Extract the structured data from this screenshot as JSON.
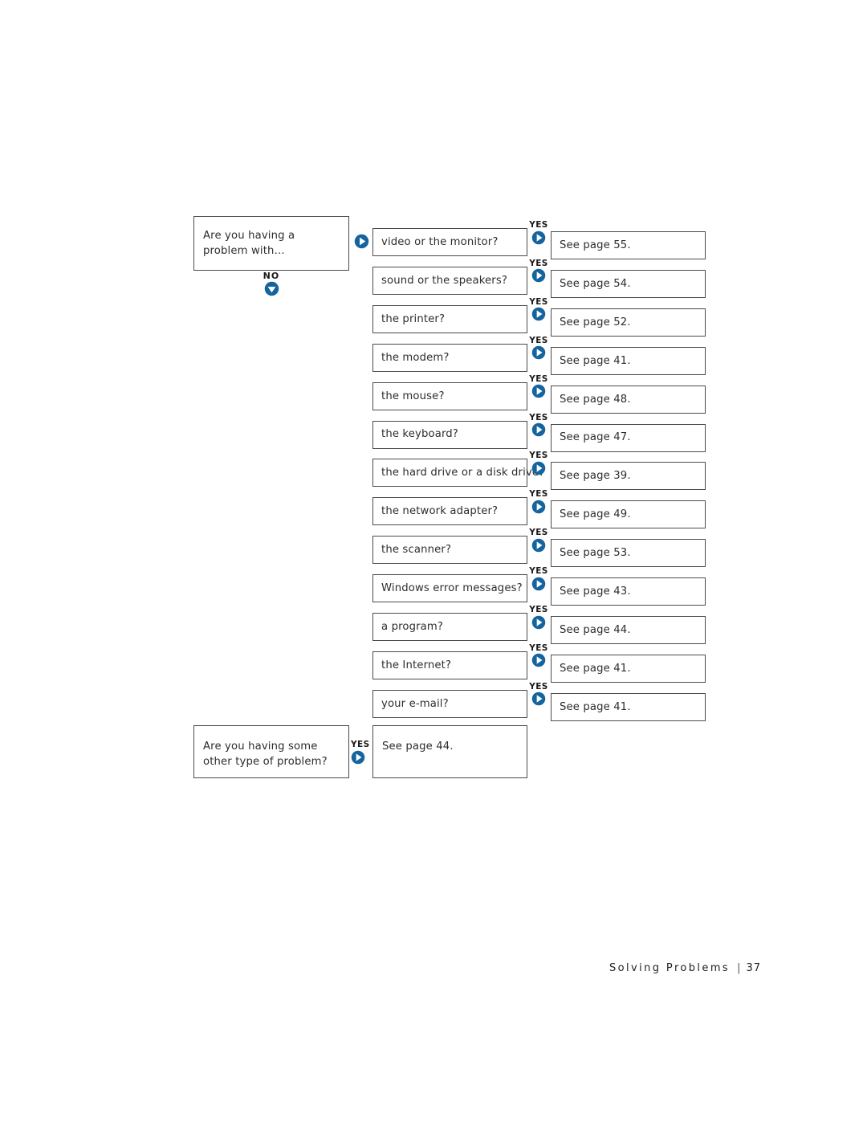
{
  "page": {
    "footer_title": "Solving Problems",
    "footer_separator": "|",
    "footer_page_number": "37"
  },
  "colors": {
    "accent_blue": "#1464A0",
    "border_gray": "#4a4a4a",
    "text_dark": "#2d2d2d",
    "background": "#ffffff"
  },
  "flowchart": {
    "root": {
      "label": "Are you having a problem with…",
      "no_branch": {
        "label": "NO",
        "icon": "circle-arrow-down-icon"
      },
      "yes_icon": "circle-arrow-right-icon"
    },
    "branch_label": "YES",
    "branch_icon": "circle-arrow-right-icon",
    "rows": [
      {
        "question": "video or the monitor?",
        "answer": "See page 55."
      },
      {
        "question": "sound or the speakers?",
        "answer": "See page 54."
      },
      {
        "question": "the printer?",
        "answer": "See page 52."
      },
      {
        "question": "the modem?",
        "answer": "See page 41."
      },
      {
        "question": "the mouse?",
        "answer": "See page 48."
      },
      {
        "question": "the keyboard?",
        "answer": "See page 47."
      },
      {
        "question": "the hard drive or a disk drive?",
        "answer": "See page 39."
      },
      {
        "question": "the network adapter?",
        "answer": "See page 49."
      },
      {
        "question": "the scanner?",
        "answer": "See page 53."
      },
      {
        "question": "Windows error messages?",
        "answer": "See page 43."
      },
      {
        "question": "a program?",
        "answer": "See page 44."
      },
      {
        "question": "the Internet?",
        "answer": "See page 41."
      },
      {
        "question": "your e-mail?",
        "answer": "See page 41."
      }
    ],
    "other": {
      "question": "Are you having some other type of problem?",
      "branch_label": "YES",
      "branch_icon": "circle-arrow-right-icon",
      "answer": "See page 44."
    }
  }
}
